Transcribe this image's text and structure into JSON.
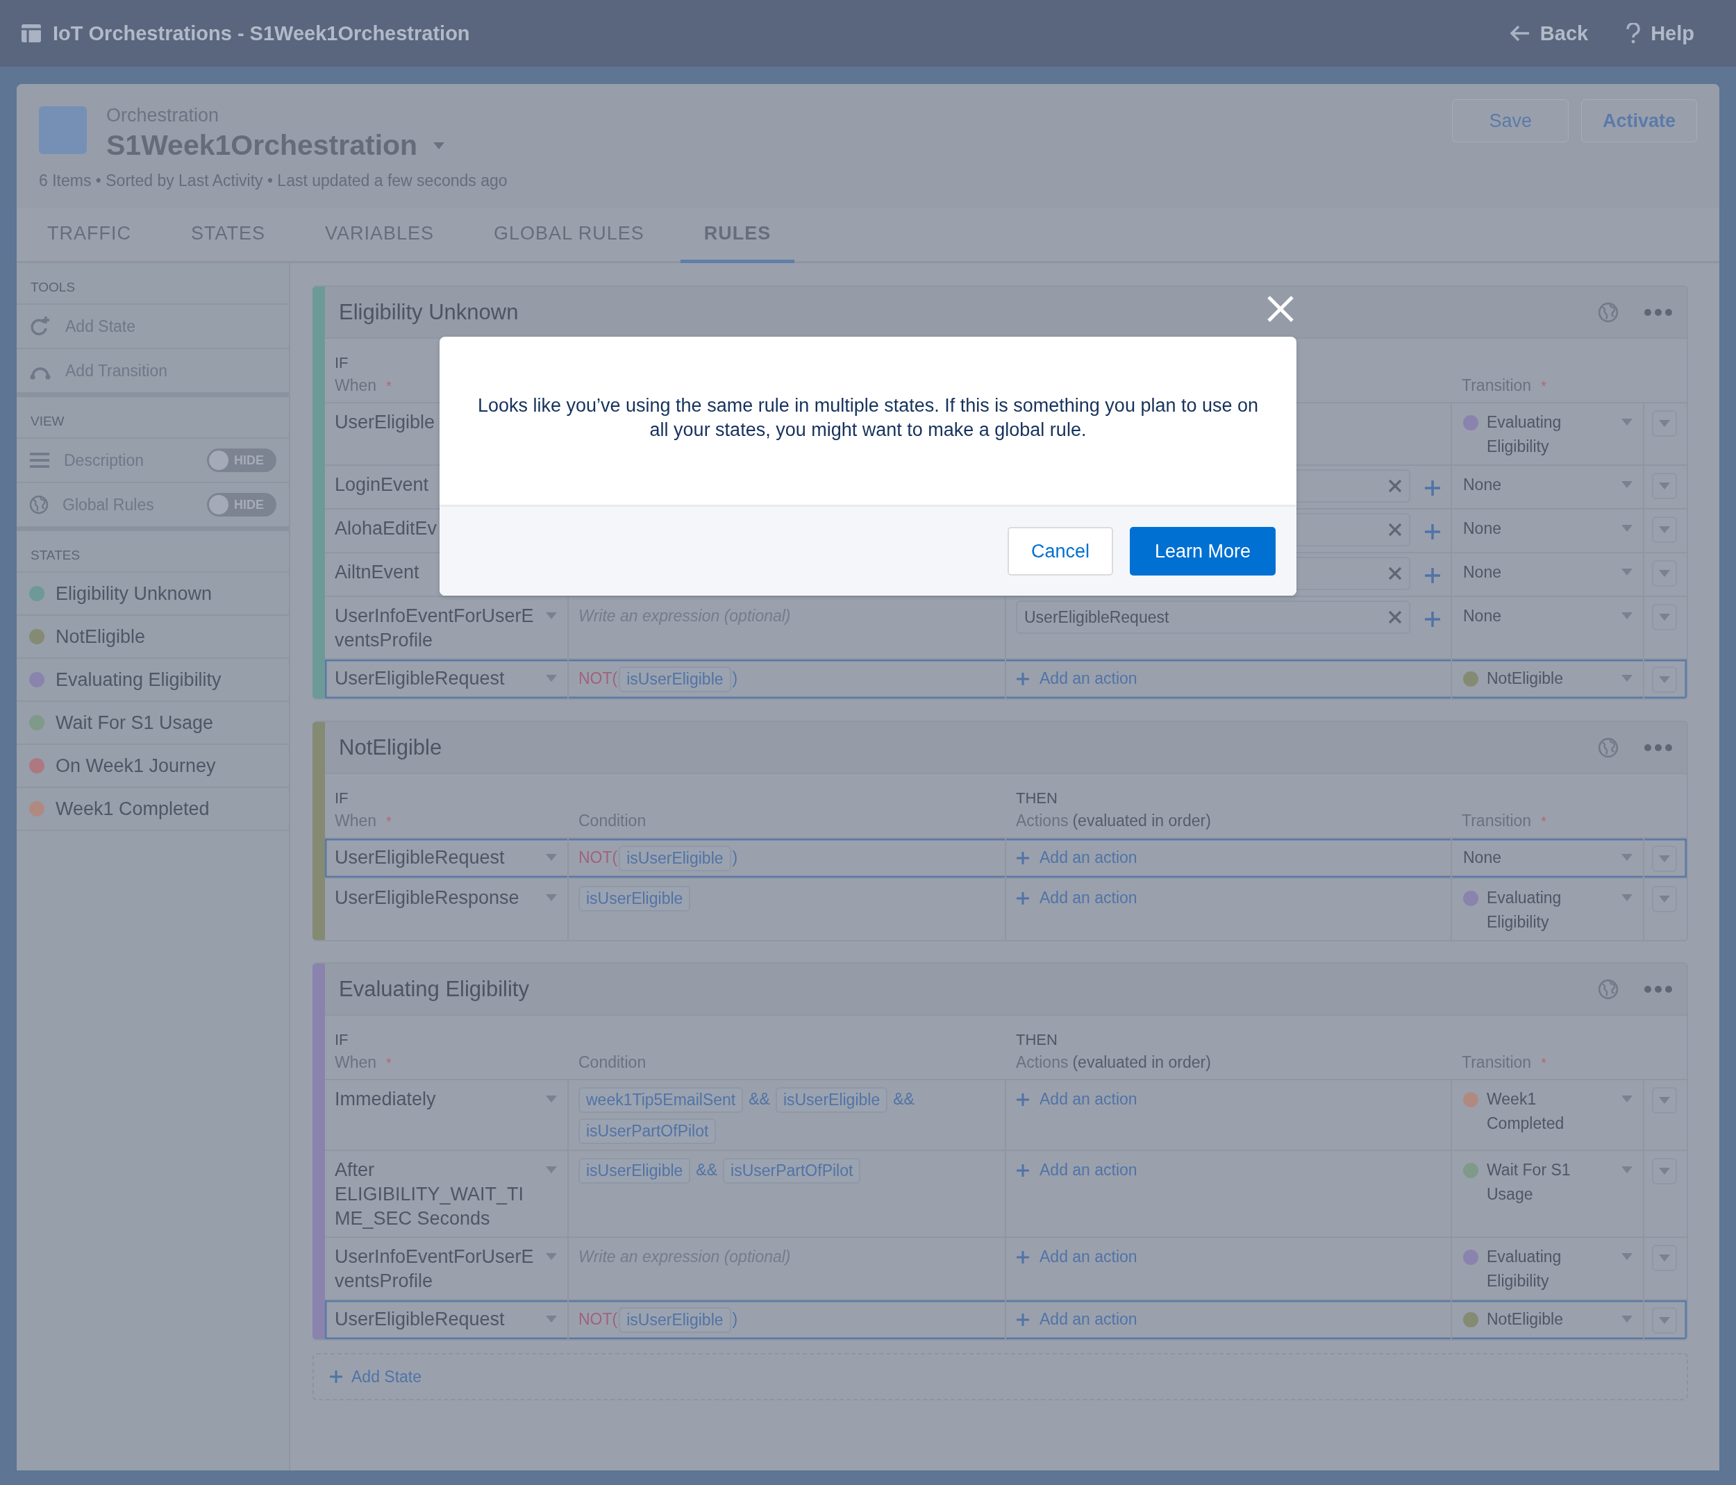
{
  "window": {
    "title": "IoT Orchestrations - S1Week1Orchestration"
  },
  "top_links": [
    {
      "label": "Back",
      "kind": "back"
    },
    {
      "label": "Help",
      "kind": "help"
    }
  ],
  "header": {
    "object_type": "Orchestration",
    "title": "S1Week1Orchestration",
    "meta": "6 Items • Sorted by Last Activity • Last updated a few seconds ago",
    "buttons": [
      {
        "label": "Save",
        "kind": "neutral"
      },
      {
        "label": "Activate",
        "kind": "brand"
      }
    ]
  },
  "tabs": [
    {
      "label": "TRAFFIC",
      "selected": false
    },
    {
      "label": "STATES",
      "selected": false
    },
    {
      "label": "VARIABLES",
      "selected": false
    },
    {
      "label": "GLOBAL RULES",
      "selected": false
    },
    {
      "label": "RULES",
      "selected": true
    }
  ],
  "sidebar": {
    "tools_heading": "TOOLS",
    "tools": [
      {
        "label": "Add State",
        "kind": "add-state"
      },
      {
        "label": "Add Transition",
        "kind": "add-transition"
      }
    ],
    "view_heading": "VIEW",
    "view": [
      {
        "label": "Description",
        "kind": "description",
        "toggle": "HIDE",
        "on": false
      },
      {
        "label": "Global Rules",
        "kind": "global",
        "toggle": "HIDE",
        "on": false
      }
    ],
    "states_heading": "STATES",
    "states": [
      {
        "name": "Eligibility Unknown",
        "color": "#6d9a96"
      },
      {
        "name": "NotEligible",
        "color": "#858a72"
      },
      {
        "name": "Evaluating Eligibility",
        "color": "#8983ad"
      },
      {
        "name": "Wait For S1 Usage",
        "color": "#7f9a88"
      },
      {
        "name": "On Week1 Journey",
        "color": "#ad7880"
      },
      {
        "name": "Week1 Completed",
        "color": "#b08a80"
      }
    ]
  },
  "cards": [
    {
      "title": "Eligibility Unknown",
      "color": "#6d9a96",
      "headers": {
        "if": "IF",
        "when": "When",
        "transition": "Transition",
        "required_mark": "*"
      },
      "rows": [
        {
          "when": "UserEligible",
          "highlighted": false,
          "transition": {
            "label": "Evaluating Eligibility",
            "color": "#8983ad"
          }
        },
        {
          "when": "LoginEvent",
          "highlighted": false,
          "actions": [
            {
              "kind": "field"
            }
          ],
          "transition": {
            "label": "None"
          }
        },
        {
          "when": "AlohaEditEv",
          "highlighted": false,
          "actions": [
            {
              "kind": "field"
            }
          ],
          "transition": {
            "label": "None"
          }
        },
        {
          "when": "AiltnEvent",
          "highlighted": false,
          "actions": [
            {
              "kind": "field"
            }
          ],
          "transition": {
            "label": "None"
          }
        },
        {
          "when": "UserInfoEventForUserEventsProfile",
          "highlighted": false,
          "condition": [
            {
              "kind": "placeholder",
              "placeholder": "Write an expression (optional)"
            }
          ],
          "actions": [
            {
              "kind": "field",
              "value": "UserEligibleRequest"
            }
          ],
          "transition": {
            "label": "None"
          }
        },
        {
          "when": "UserEligibleRequest",
          "highlighted": true,
          "condition": [
            {
              "kind": "function",
              "text": "NOT("
            },
            {
              "kind": "variable",
              "text": "isUserEligible"
            },
            {
              "kind": "paren",
              "text": ")"
            }
          ],
          "actions": [
            {
              "kind": "add",
              "label": "Add an action"
            }
          ],
          "transition": {
            "label": "NotEligible",
            "color": "#858a72"
          }
        }
      ]
    },
    {
      "title": "NotEligible",
      "color": "#858a72",
      "headers": {
        "if": "IF",
        "then": "THEN",
        "when": "When",
        "condition": "Condition",
        "actions": "Actions",
        "actions_note": "(evaluated in order)",
        "transition": "Transition",
        "required_mark": "*"
      },
      "rows": [
        {
          "when": "UserEligibleRequest",
          "highlighted": true,
          "condition": [
            {
              "kind": "function",
              "text": "NOT("
            },
            {
              "kind": "variable",
              "text": "isUserEligible"
            },
            {
              "kind": "paren",
              "text": ")"
            }
          ],
          "actions": [
            {
              "kind": "add",
              "label": "Add an action"
            }
          ],
          "transition": {
            "label": "None"
          }
        },
        {
          "when": "UserEligibleResponse",
          "highlighted": false,
          "condition": [
            {
              "kind": "variable",
              "text": "isUserEligible"
            }
          ],
          "actions": [
            {
              "kind": "add",
              "label": "Add an action"
            }
          ],
          "transition": {
            "label": "Evaluating Eligibility",
            "color": "#8983ad"
          }
        }
      ]
    },
    {
      "title": "Evaluating Eligibility",
      "color": "#8983ad",
      "headers": {
        "if": "IF",
        "then": "THEN",
        "when": "When",
        "condition": "Condition",
        "actions": "Actions",
        "actions_note": "(evaluated in order)",
        "transition": "Transition",
        "required_mark": "*"
      },
      "rows": [
        {
          "when": "Immediately",
          "highlighted": false,
          "condition": [
            {
              "kind": "variable",
              "text": "week1Tip5EmailSent"
            },
            {
              "kind": "operator",
              "text": "&&"
            },
            {
              "kind": "variable",
              "text": "isUserEligible"
            },
            {
              "kind": "operator",
              "text": "&&"
            },
            {
              "kind": "variable",
              "text": "isUserPartOfPilot"
            }
          ],
          "actions": [
            {
              "kind": "add",
              "label": "Add an action"
            }
          ],
          "transition": {
            "label": "Week1 Completed",
            "color": "#b08a80"
          }
        },
        {
          "when": "After ELIGIBILITY_WAIT_TIME_SEC Seconds",
          "highlighted": false,
          "condition": [
            {
              "kind": "variable",
              "text": "isUserEligible"
            },
            {
              "kind": "operator",
              "text": "&&"
            },
            {
              "kind": "variable",
              "text": "isUserPartOfPilot"
            }
          ],
          "actions": [
            {
              "kind": "add",
              "label": "Add an action"
            }
          ],
          "transition": {
            "label": "Wait For S1 Usage",
            "color": "#7f9a88"
          }
        },
        {
          "when": "UserInfoEventForUserEventsProfile",
          "highlighted": false,
          "condition": [
            {
              "kind": "placeholder",
              "placeholder": "Write an expression (optional)"
            }
          ],
          "actions": [
            {
              "kind": "add",
              "label": "Add an action"
            }
          ],
          "transition": {
            "label": "Evaluating Eligibility",
            "color": "#8983ad"
          }
        },
        {
          "when": "UserEligibleRequest",
          "highlighted": true,
          "condition": [
            {
              "kind": "function",
              "text": "NOT("
            },
            {
              "kind": "variable",
              "text": "isUserEligible"
            },
            {
              "kind": "paren",
              "text": ")"
            }
          ],
          "actions": [
            {
              "kind": "add",
              "label": "Add an action"
            }
          ],
          "transition": {
            "label": "NotEligible",
            "color": "#858a72"
          }
        }
      ]
    }
  ],
  "add_state": {
    "label": "Add State"
  },
  "modal": {
    "message": "Looks like you’ve using the same rule in multiple states. If this is something you plan to use on all your states, you might want to make a global rule.",
    "buttons": [
      {
        "label": "Cancel",
        "kind": "neutral"
      },
      {
        "label": "Learn More",
        "kind": "brand"
      }
    ]
  }
}
